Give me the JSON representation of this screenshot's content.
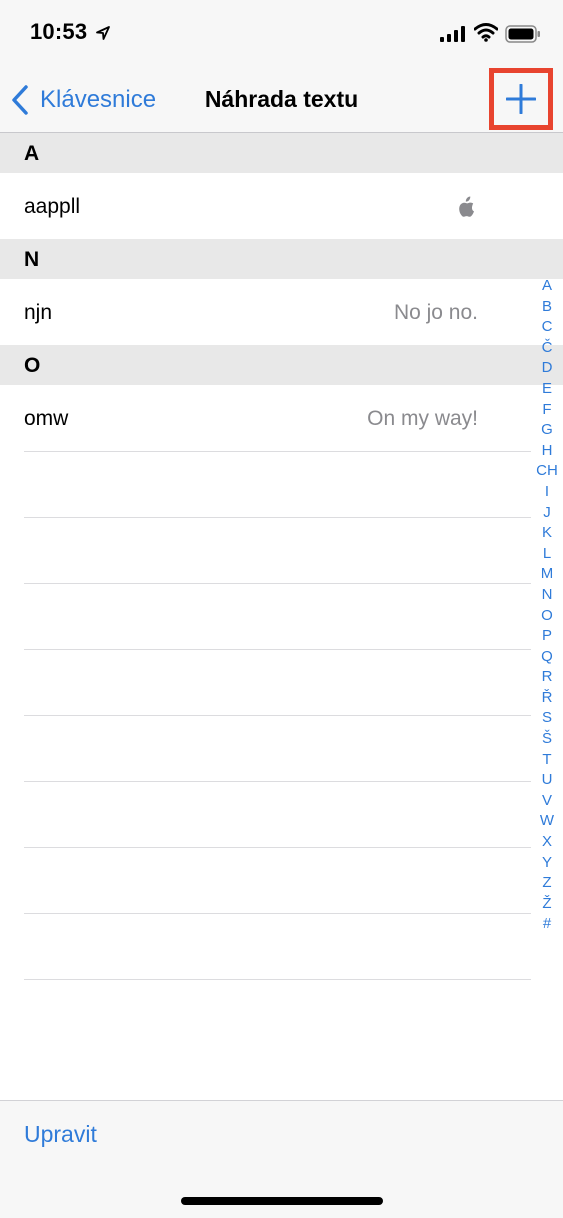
{
  "status_bar": {
    "time": "10:53",
    "icons": [
      "location-arrow-icon",
      "signal-icon",
      "wifi-icon",
      "battery-icon"
    ]
  },
  "nav": {
    "back_label": "Klávesnice",
    "title": "Náhrada textu",
    "add_icon": "plus-icon"
  },
  "sections": [
    {
      "header": "A",
      "rows": [
        {
          "shortcut": "aappll",
          "phrase": "",
          "icon": "apple-logo-icon"
        }
      ]
    },
    {
      "header": "N",
      "rows": [
        {
          "shortcut": "njn",
          "phrase": "No jo no."
        }
      ]
    },
    {
      "header": "O",
      "rows": [
        {
          "shortcut": "omw",
          "phrase": "On my way!"
        }
      ]
    }
  ],
  "index": [
    "A",
    "B",
    "C",
    "Č",
    "D",
    "E",
    "F",
    "G",
    "H",
    "CH",
    "I",
    "J",
    "K",
    "L",
    "M",
    "N",
    "O",
    "P",
    "Q",
    "R",
    "Ř",
    "S",
    "Š",
    "T",
    "U",
    "V",
    "W",
    "X",
    "Y",
    "Z",
    "Ž",
    "#"
  ],
  "toolbar": {
    "edit_label": "Upravit"
  },
  "colors": {
    "accent": "#2f7bd9",
    "highlight": "#e8442f",
    "secondary_text": "#8a8a8e",
    "section_bg": "#e8e8e8"
  }
}
